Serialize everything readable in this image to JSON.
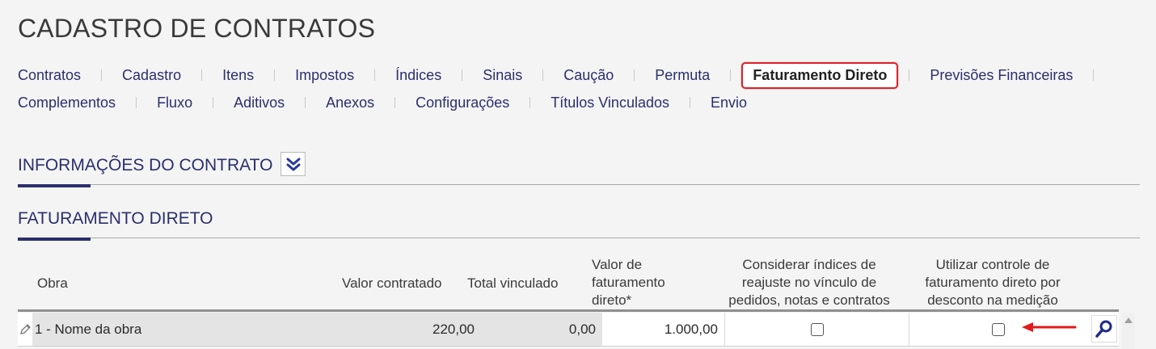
{
  "page": {
    "title": "CADASTRO DE CONTRATOS"
  },
  "tabs": {
    "row1": [
      "Contratos",
      "Cadastro",
      "Itens",
      "Impostos",
      "Índices",
      "Sinais",
      "Caução",
      "Permuta",
      "Faturamento Direto",
      "Previsões Financeiras"
    ],
    "row2": [
      "Complementos",
      "Fluxo",
      "Aditivos",
      "Anexos",
      "Configurações",
      "Títulos Vinculados",
      "Envio"
    ],
    "active": "Faturamento Direto"
  },
  "sections": {
    "contract_info": "INFORMAÇÕES DO CONTRATO",
    "direct_billing": "FATURAMENTO DIRETO"
  },
  "table": {
    "headers": {
      "obra": "Obra",
      "valor_contratado": "Valor contratado",
      "total_vinculado": "Total vinculado",
      "valor_faturamento_l1": "Valor de",
      "valor_faturamento_l2": "faturamento",
      "valor_faturamento_l3": "direto*",
      "considerar_l1": "Considerar índices de",
      "considerar_l2": "reajuste no vínculo de",
      "considerar_l3": "pedidos, notas e contratos",
      "utilizar_l1": "Utilizar controle de",
      "utilizar_l2": "faturamento direto por",
      "utilizar_l3": "desconto na medição"
    },
    "rows": [
      {
        "obra": "1 - Nome da obra",
        "valor_contratado": "220,00",
        "total_vinculado": "0,00",
        "valor_faturamento": "1.000,00",
        "considerar_indices": false,
        "utilizar_controle": false
      }
    ]
  },
  "colors": {
    "accent": "#2a2f6e",
    "highlight": "#d9242a"
  },
  "icons": [
    "pencil-icon",
    "double-chevron-down-icon",
    "search-icon",
    "red-arrow-icon",
    "scroll-up-icon"
  ]
}
